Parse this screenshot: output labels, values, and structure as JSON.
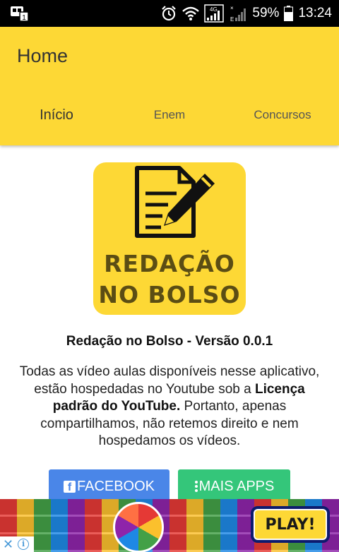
{
  "status_bar": {
    "battery_percent": "59%",
    "time": "13:24",
    "network": "4G",
    "icons": [
      "notification-icon",
      "alarm-icon",
      "wifi-icon",
      "signal-4g-icon",
      "signal-icon",
      "battery-icon"
    ]
  },
  "app_bar": {
    "title": "Home",
    "tabs": [
      {
        "label": "Início",
        "active": true
      },
      {
        "label": "Enem",
        "active": false
      },
      {
        "label": "Concursos",
        "active": false
      }
    ],
    "color": "#fdd835"
  },
  "logo": {
    "line1": "REDAÇÃO",
    "line2": "NO BOLSO",
    "icon": "document-pencil-icon"
  },
  "main": {
    "version": "Redação no Bolso - Versão 0.0.1",
    "description_part1": "Todas as vídeo aulas disponíveis nesse aplicativo, estão hospedadas no Youtube sob a ",
    "description_bold": "Licença padrão do YouTube.",
    "description_part2": " Portanto, apenas compartilhamos, não retemos direito e nem hospedamos os vídeos."
  },
  "buttons": {
    "facebook_label": "FACEBOOK",
    "facebook_glyph": "f",
    "more_apps_label": "MAIS APPS",
    "facebook_color": "#4a86e8",
    "more_apps_color": "#34c67a"
  },
  "ad": {
    "play_label": "PLAY!",
    "close_glyph": "✕",
    "info_glyph": "i"
  }
}
